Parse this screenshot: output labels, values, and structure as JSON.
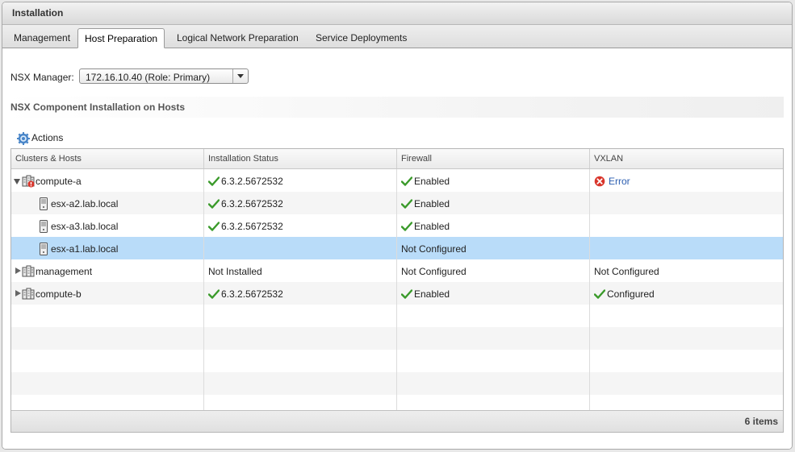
{
  "window": {
    "title": "Installation"
  },
  "tabs": [
    {
      "label": "Management",
      "active": false
    },
    {
      "label": "Host Preparation",
      "active": true
    },
    {
      "label": "Logical Network Preparation",
      "active": false
    },
    {
      "label": "Service Deployments",
      "active": false
    }
  ],
  "nsx_manager": {
    "label": "NSX Manager:",
    "selected": "172.16.10.40 (Role: Primary)"
  },
  "section": {
    "title": "NSX Component Installation on Hosts"
  },
  "toolbar": {
    "actions_label": "Actions",
    "actions_icon": "gear-icon"
  },
  "grid": {
    "columns": [
      "Clusters & Hosts",
      "Installation Status",
      "Firewall",
      "VXLAN"
    ],
    "rows": [
      {
        "name": "compute-a",
        "type": "cluster",
        "expanded": true,
        "error_badge": true,
        "install": "6.3.2.5672532",
        "install_ok": true,
        "firewall": "Enabled",
        "firewall_ok": true,
        "vxlan": "Error",
        "vxlan_state": "error"
      },
      {
        "name": "esx-a2.lab.local",
        "type": "host",
        "install": "6.3.2.5672532",
        "install_ok": true,
        "firewall": "Enabled",
        "firewall_ok": true,
        "vxlan": "",
        "vxlan_state": "none"
      },
      {
        "name": "esx-a3.lab.local",
        "type": "host",
        "install": "6.3.2.5672532",
        "install_ok": true,
        "firewall": "Enabled",
        "firewall_ok": true,
        "vxlan": "",
        "vxlan_state": "none"
      },
      {
        "name": "esx-a1.lab.local",
        "type": "host",
        "selected": true,
        "install": "",
        "install_ok": false,
        "firewall": "Not Configured",
        "firewall_ok": false,
        "vxlan": "",
        "vxlan_state": "none"
      },
      {
        "name": "management",
        "type": "cluster",
        "expanded": false,
        "install": "Not Installed",
        "install_ok": false,
        "firewall": "Not Configured",
        "firewall_ok": false,
        "vxlan": "Not Configured",
        "vxlan_state": "plain"
      },
      {
        "name": "compute-b",
        "type": "cluster",
        "expanded": false,
        "install": "6.3.2.5672532",
        "install_ok": true,
        "firewall": "Enabled",
        "firewall_ok": true,
        "vxlan": "Configured",
        "vxlan_state": "ok"
      }
    ],
    "footer": {
      "count": "6 items"
    }
  },
  "colors": {
    "selected_row": "#b9dcf9",
    "ok_check": "#3a9a2a",
    "error": "#d9352b",
    "link": "#2a5db0"
  }
}
